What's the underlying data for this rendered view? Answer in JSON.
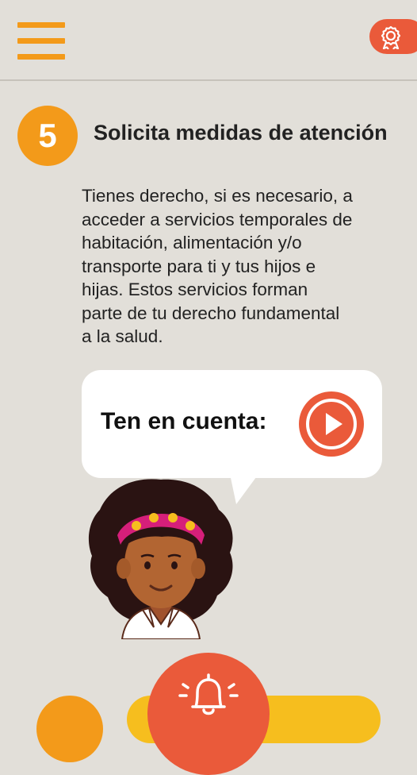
{
  "header": {
    "menu_icon": "hamburger-menu-icon",
    "award_icon": "award-ribbon-icon"
  },
  "step": {
    "number": "5",
    "title": "Solicita medidas de atención"
  },
  "body": {
    "lines": [
      "Tienes derecho, si es necesario, a",
      "acceder a servicios temporales de",
      "habitación, alimentación y/o",
      "transporte para ti y tus hijos e",
      "hijas. Estos servicios forman",
      "parte de tu derecho fundamental",
      "a la salud."
    ]
  },
  "bubble": {
    "label": "Ten en cuenta:",
    "play_icon": "play-icon"
  },
  "bottom": {
    "alert_icon": "bell-alert-icon"
  },
  "colors": {
    "background": "#e2dfd9",
    "orange": "#f39a1a",
    "coral": "#ea5a3a",
    "yellow": "#f6be1e"
  }
}
